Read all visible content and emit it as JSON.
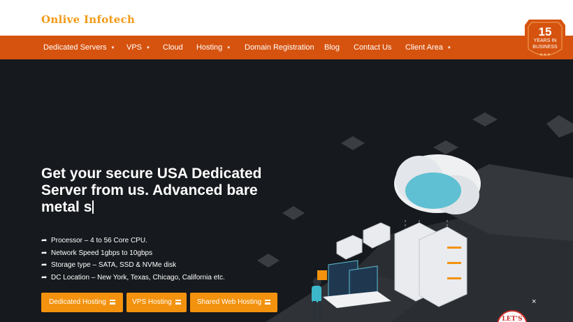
{
  "brand": {
    "logo_text": "Onlive Infotech"
  },
  "badge": {
    "number": "15",
    "line1": "YEARS IN",
    "line2": "BUSINESS",
    "stars": "★★★"
  },
  "nav": {
    "items": [
      {
        "label": "Dedicated Servers",
        "caret": "▼"
      },
      {
        "label": "VPS",
        "caret": "▼"
      },
      {
        "label": "Cloud"
      },
      {
        "label": "Hosting",
        "caret": "▼"
      },
      {
        "label": "Domain Registration"
      },
      {
        "label": "Blog"
      },
      {
        "label": "Contact Us"
      },
      {
        "label": "Client Area",
        "caret": "▼"
      }
    ]
  },
  "hero": {
    "headline": "Get your secure USA Dedicated Server from us. Advanced bare metal s",
    "features": [
      "Processor – 4 to 56 Core CPU.",
      "Network Speed 1gbps to 10gbps",
      "Storage type – SATA, SSD & NVMe disk",
      "DC Location – New York, Texas, Chicago, California etc."
    ],
    "buttons": [
      "Dedicated Hosting",
      "VPS Hosting",
      "Shared Web Hosting"
    ]
  },
  "chat": {
    "close_label": "×",
    "lets_text": "LET'S"
  },
  "colors": {
    "nav_bg": "#d6530f",
    "button_bg": "#f3920e",
    "logo": "#f29a16",
    "hero_bg": "#16191d"
  }
}
